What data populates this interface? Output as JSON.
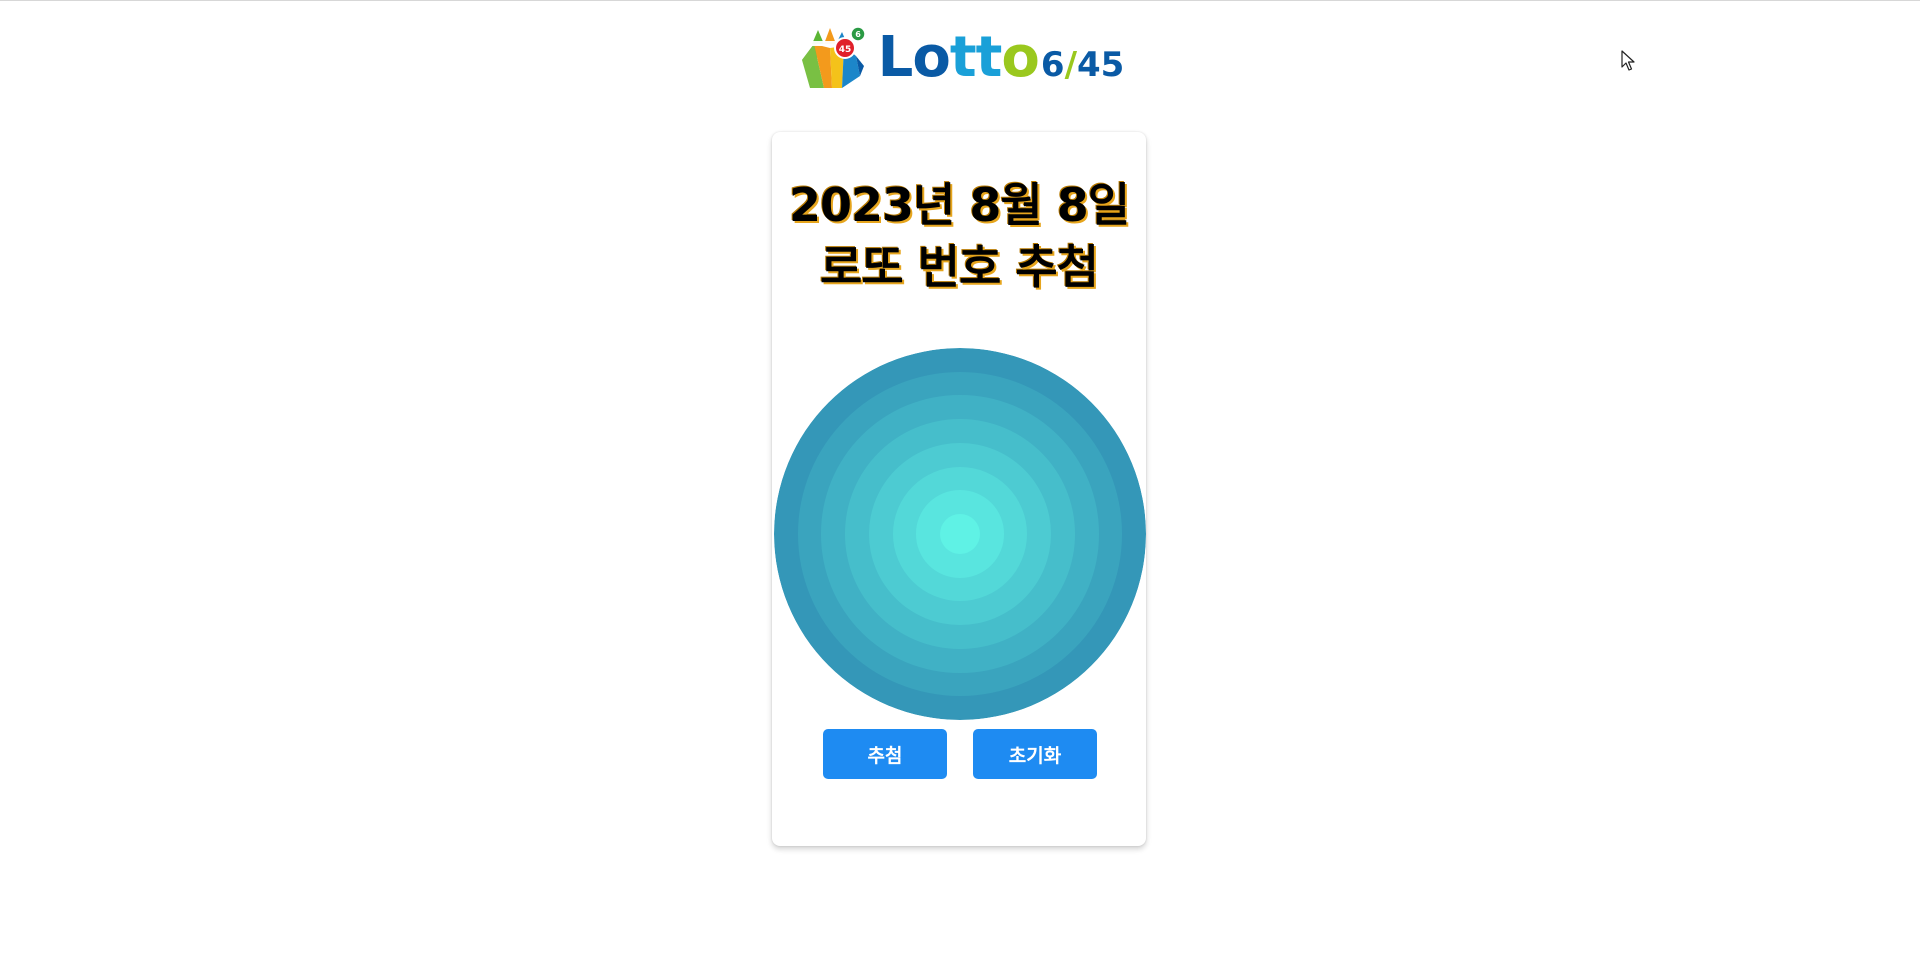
{
  "header": {
    "logo": {
      "ball_numbers": [
        "45",
        "6"
      ],
      "word_letters": [
        "L",
        "o",
        "t",
        "t",
        "o"
      ],
      "sub_main": "6",
      "sub_slash": "/",
      "sub_rest": "45",
      "colors": {
        "blue": "#0a5aa5",
        "cyan": "#1aa0d8",
        "green": "#9ac81e",
        "red": "#e0202a"
      }
    }
  },
  "card": {
    "title_line1": "2023년 8월 8일",
    "title_line2": "로또 번호 추첨",
    "drum": {
      "colors": {
        "outer": "#3497b8",
        "inner": "#5ff2e5"
      }
    },
    "buttons": {
      "draw_label": "추첨",
      "reset_label": "초기화",
      "color": "#1e8bf2"
    }
  },
  "icons": {
    "cursor": "mouse-pointer-icon",
    "logo_mark": "lotto-ball-pouch-icon"
  }
}
